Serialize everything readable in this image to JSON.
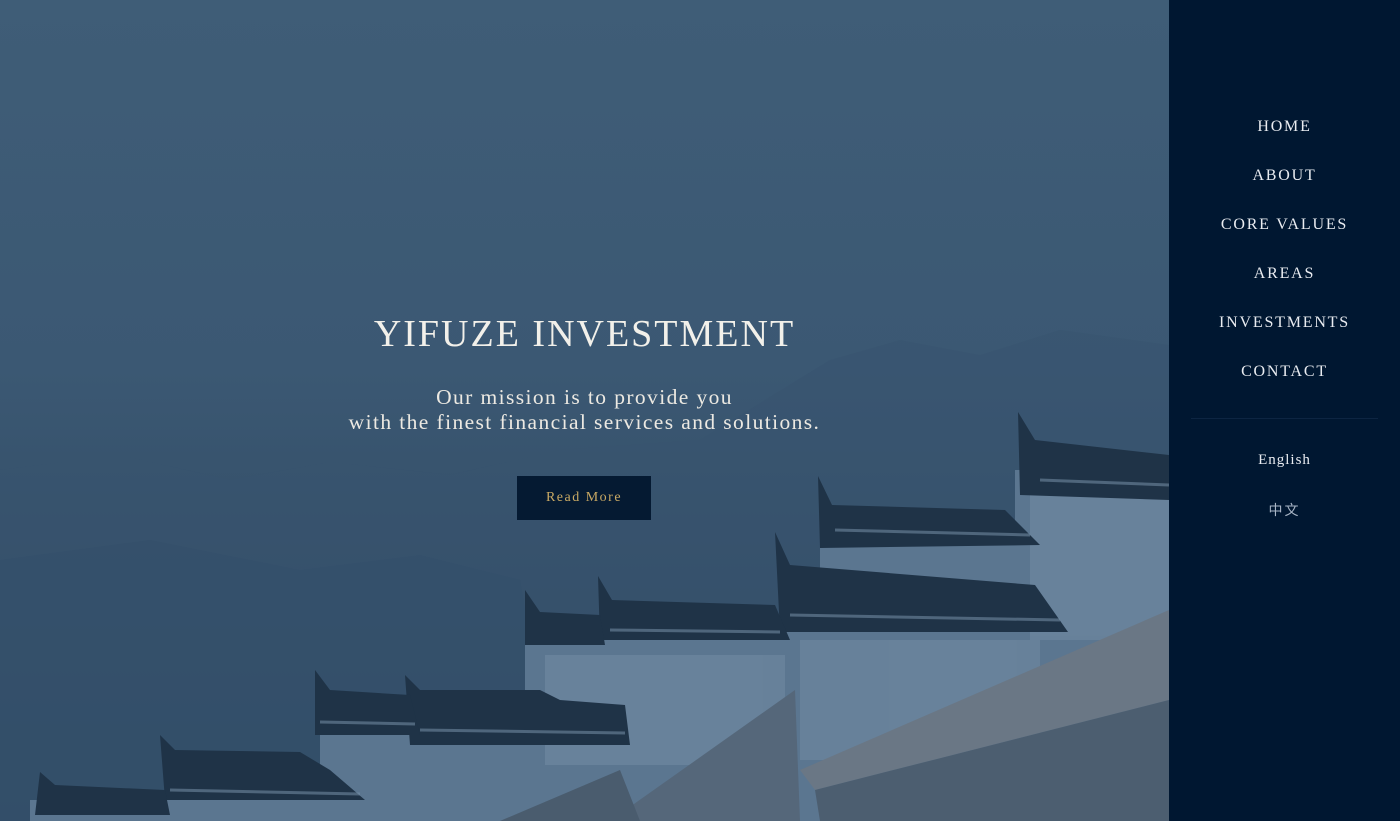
{
  "hero": {
    "title": "YIFUZE INVESTMENT",
    "mission_line1": "Our mission is to provide you",
    "mission_line2": "with the finest financial services and solutions.",
    "cta_label": "Read More"
  },
  "nav": {
    "items": [
      "HOME",
      "ABOUT",
      "CORE VALUES",
      "AREAS",
      "INVESTMENTS",
      "CONTACT"
    ],
    "languages": [
      "English",
      "中文"
    ]
  },
  "colors": {
    "sidebar_bg": "#001731",
    "hero_overlay": "#3b5873",
    "cta_bg": "#051a32",
    "cta_text": "#c9a964"
  }
}
